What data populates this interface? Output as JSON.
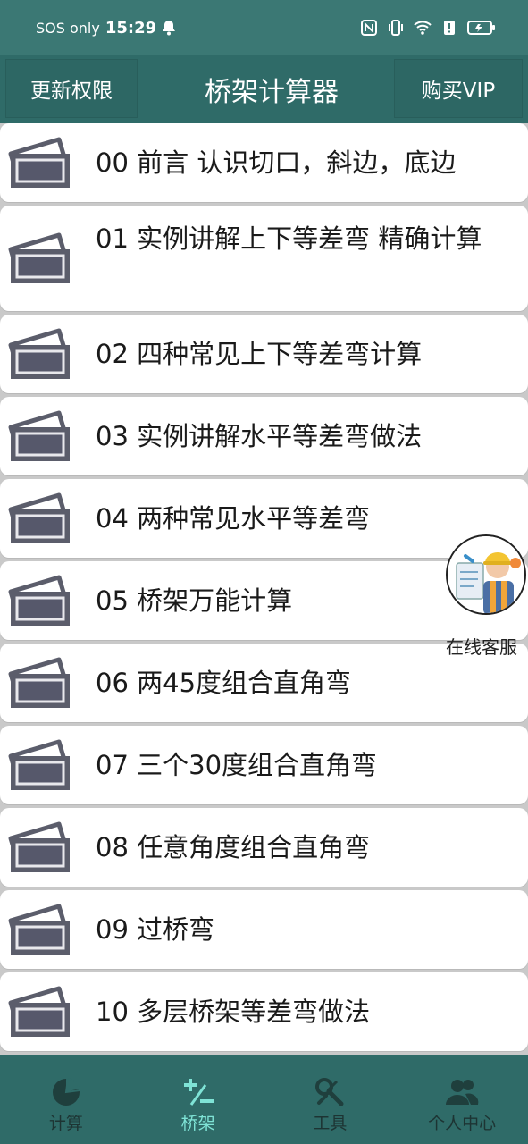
{
  "status": {
    "carrier": "SOS only",
    "time": "15:29"
  },
  "header": {
    "left_button": "更新权限",
    "title": "桥架计算器",
    "right_button": "购买VIP"
  },
  "lessons": [
    {
      "label": "00 前言 认识切口，斜边，底边"
    },
    {
      "label": "01 实例讲解上下等差弯 精确计算"
    },
    {
      "label": "02 四种常见上下等差弯计算"
    },
    {
      "label": "03 实例讲解水平等差弯做法"
    },
    {
      "label": "04 两种常见水平等差弯"
    },
    {
      "label": "05 桥架万能计算"
    },
    {
      "label": "06 两45度组合直角弯"
    },
    {
      "label": "07 三个30度组合直角弯"
    },
    {
      "label": "08 任意角度组合直角弯"
    },
    {
      "label": "09 过桥弯"
    },
    {
      "label": "10 多层桥架等差弯做法"
    }
  ],
  "support": {
    "label": "在线客服"
  },
  "nav": {
    "items": [
      {
        "label": "计算",
        "icon": "pie-chart-icon",
        "active": false
      },
      {
        "label": "桥架",
        "icon": "plus-minus-icon",
        "active": true
      },
      {
        "label": "工具",
        "icon": "tools-icon",
        "active": false
      },
      {
        "label": "个人中心",
        "icon": "users-icon",
        "active": false
      }
    ]
  },
  "colors": {
    "bar": "#2f6b68",
    "active_nav": "#7fe3d6",
    "row_bg": "#ffffff",
    "list_bg": "#c9c9c9"
  }
}
